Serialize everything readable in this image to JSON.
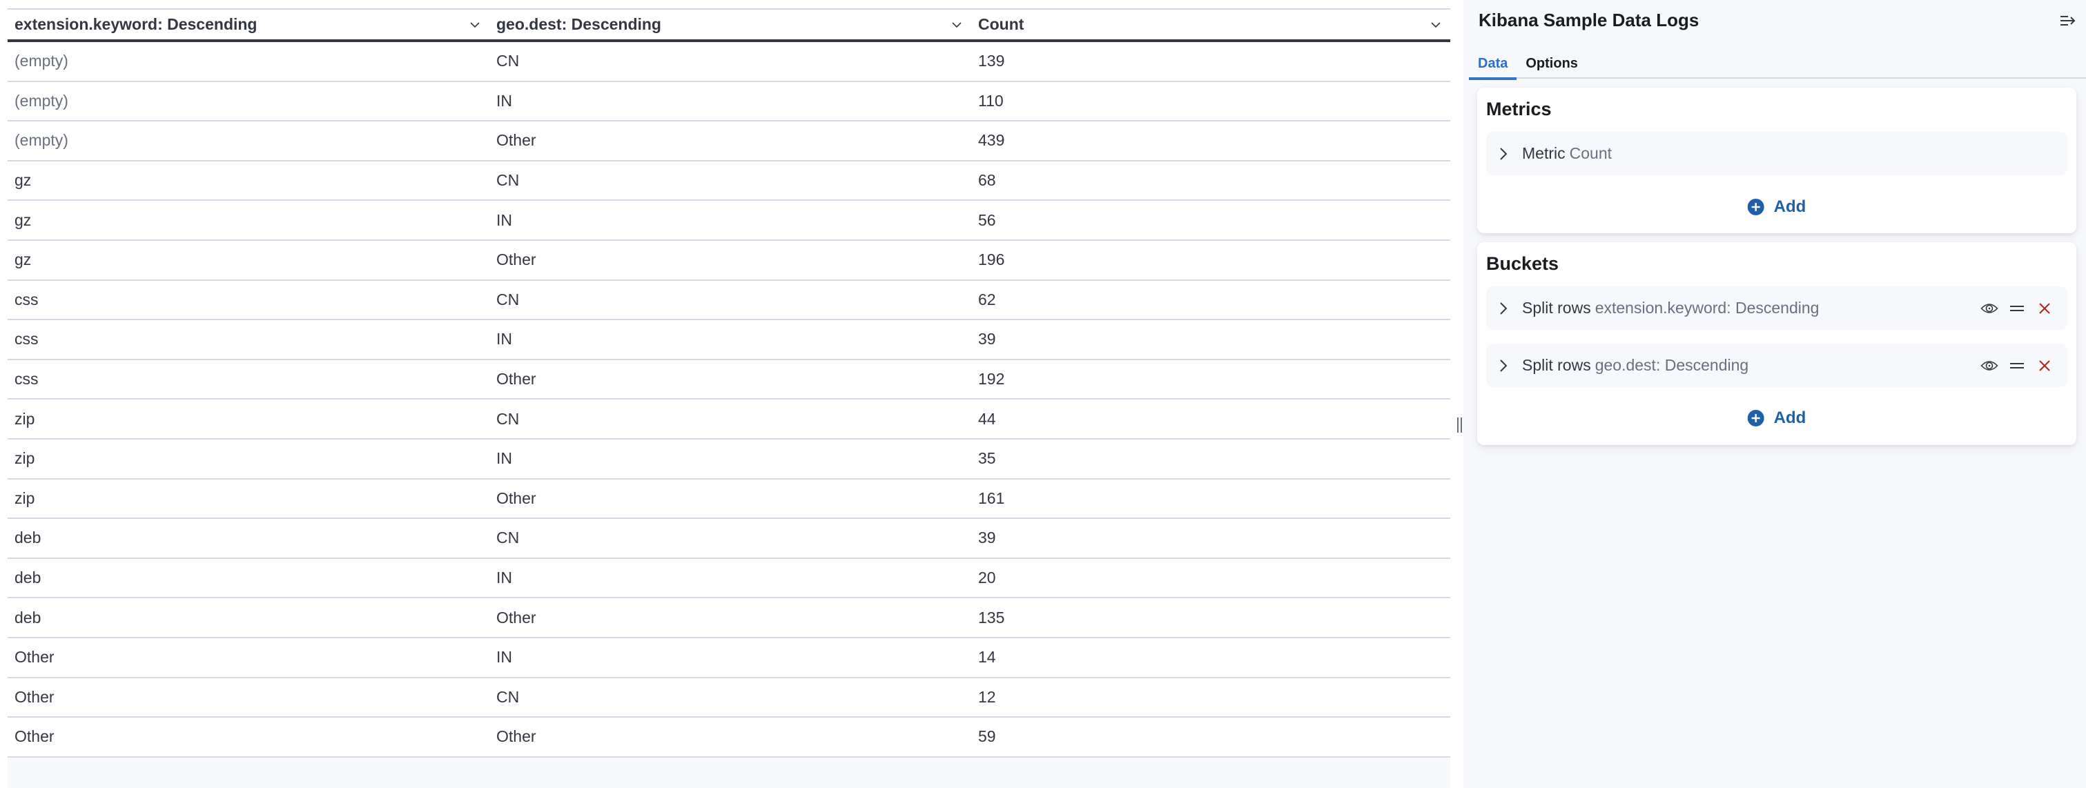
{
  "table": {
    "columns": [
      {
        "label": "extension.keyword: Descending"
      },
      {
        "label": "geo.dest: Descending"
      },
      {
        "label": "Count"
      }
    ],
    "rows": [
      {
        "extension": "(empty)",
        "geo": "CN",
        "count": "139",
        "is_empty": true
      },
      {
        "extension": "(empty)",
        "geo": "IN",
        "count": "110",
        "is_empty": true
      },
      {
        "extension": "(empty)",
        "geo": "Other",
        "count": "439",
        "is_empty": true
      },
      {
        "extension": "gz",
        "geo": "CN",
        "count": "68"
      },
      {
        "extension": "gz",
        "geo": "IN",
        "count": "56"
      },
      {
        "extension": "gz",
        "geo": "Other",
        "count": "196"
      },
      {
        "extension": "css",
        "geo": "CN",
        "count": "62"
      },
      {
        "extension": "css",
        "geo": "IN",
        "count": "39"
      },
      {
        "extension": "css",
        "geo": "Other",
        "count": "192"
      },
      {
        "extension": "zip",
        "geo": "CN",
        "count": "44"
      },
      {
        "extension": "zip",
        "geo": "IN",
        "count": "35"
      },
      {
        "extension": "zip",
        "geo": "Other",
        "count": "161"
      },
      {
        "extension": "deb",
        "geo": "CN",
        "count": "39"
      },
      {
        "extension": "deb",
        "geo": "IN",
        "count": "20"
      },
      {
        "extension": "deb",
        "geo": "Other",
        "count": "135"
      },
      {
        "extension": "Other",
        "geo": "IN",
        "count": "14"
      },
      {
        "extension": "Other",
        "geo": "CN",
        "count": "12"
      },
      {
        "extension": "Other",
        "geo": "Other",
        "count": "59"
      }
    ]
  },
  "sidebar": {
    "title": "Kibana Sample Data Logs",
    "collapse_icon": "menu-right-icon",
    "tabs": [
      {
        "label": "Data",
        "active": true
      },
      {
        "label": "Options",
        "active": false
      }
    ],
    "metrics": {
      "title": "Metrics",
      "items": [
        {
          "label": "Metric",
          "description": "Count"
        }
      ],
      "add_label": "Add"
    },
    "buckets": {
      "title": "Buckets",
      "items": [
        {
          "label": "Split rows",
          "description": "extension.keyword: Descending"
        },
        {
          "label": "Split rows",
          "description": "geo.dest: Descending"
        }
      ],
      "add_label": "Add"
    }
  },
  "colors": {
    "accent": "#2b70c2",
    "add_button": "#1f5fa8",
    "remove_icon": "#a5271f",
    "text": "#343741",
    "subdued_text": "#69707d",
    "panel_bg": "#f7f8fc",
    "border": "#d3dae6"
  }
}
